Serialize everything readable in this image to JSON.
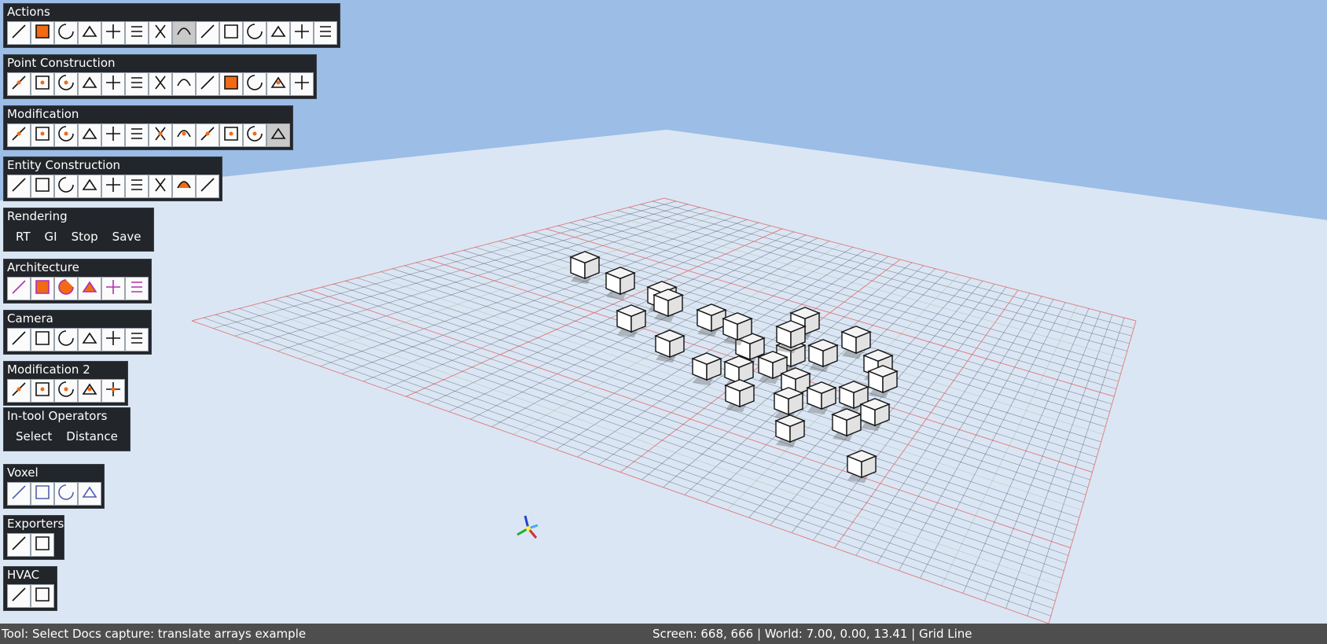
{
  "panels": {
    "actions": {
      "title": "Actions",
      "tools": [
        "new-file-icon",
        "save-icon",
        "undo-icon",
        "redo-icon",
        "new-file-2-icon",
        "save-as-icon",
        "plane-icon",
        "drop-icon",
        "delete-icon",
        "select-box-icon",
        "select-box-2-icon",
        "plane-flat-icon",
        "lightbulb-icon",
        "plug-icon"
      ]
    },
    "point_construction": {
      "title": "Point Construction",
      "tools": [
        "point-icon",
        "point-axis-icon",
        "point-grid-icon",
        "zigzag-line-icon",
        "line-icon",
        "arc-icon",
        "parallel-lines-icon",
        "rectangle-icon",
        "polyline-plane-icon",
        "filled-plane-icon",
        "box-icon",
        "rotated-rect-icon",
        "circle-icon"
      ]
    },
    "modification": {
      "title": "Modification",
      "tools": [
        "select-arrow-icon",
        "move-icon",
        "rotate-icon",
        "scale-icon",
        "extrude-icon",
        "extrude-2-icon",
        "translate-arrow-icon",
        "array-icon",
        "array-3d-icon",
        "rotate-array-icon",
        "path-array-icon",
        "step-icon"
      ]
    },
    "entity_construction": {
      "title": "Entity Construction",
      "tools": [
        "dimension-icon",
        "text-leader-icon",
        "text-icon",
        "curve-icon",
        "face-icon",
        "section-icon",
        "extrude-face-icon",
        "block-icon",
        "cut-icon"
      ]
    },
    "rendering": {
      "title": "Rendering",
      "buttons": [
        "RT",
        "GI",
        "Stop",
        "Save"
      ]
    },
    "architecture": {
      "title": "Architecture",
      "tools": [
        "stairs-icon",
        "slab-icon",
        "beam-icon",
        "window-icon",
        "panel-icon",
        "door-icon"
      ]
    },
    "camera": {
      "title": "Camera",
      "tools": [
        "orbit-icon",
        "person-icon",
        "axes-icon",
        "globe-icon",
        "axes-color-icon",
        "zoom-icon"
      ]
    },
    "modification2": {
      "title": "Modification 2",
      "tools": [
        "rotate-dots-icon",
        "rotate-array-2-icon",
        "path-array-2-icon",
        "rotate-array-3-icon",
        "path-array-3-icon"
      ]
    },
    "intool": {
      "title": "In-tool Operators",
      "buttons": [
        "Select",
        "Distance"
      ]
    },
    "voxel": {
      "title": "Voxel",
      "tools": [
        "voxel-grid-icon",
        "voxel-cube-icon",
        "voxel-stack-icon",
        "voxel-merge-icon"
      ]
    },
    "exporters": {
      "title": "Exporters",
      "tools": [
        "export-icon",
        "export-2-icon"
      ]
    },
    "hvac": {
      "title": "HVAC",
      "tools": [
        "duct-icon",
        "hvac-unit-icon"
      ]
    }
  },
  "status": {
    "left": "Tool: Select Docs capture: translate arrays example",
    "right": "Screen: 668, 666 | World: 7.00, 0.00, 13.41 | Grid Line"
  },
  "colors": {
    "sky": "#9bbde6",
    "ground": "#dbe6f4",
    "panel": "#22262b",
    "statusbar": "#4e4e4e",
    "accent": "#f26a12"
  }
}
